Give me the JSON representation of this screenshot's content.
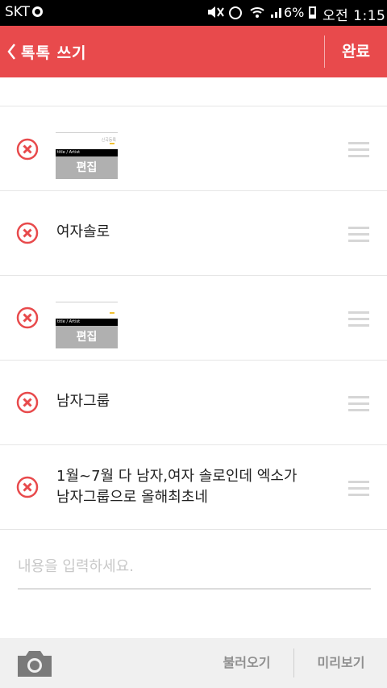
{
  "status_bar": {
    "carrier": "SKT",
    "battery_percent": "6%",
    "time": "오전 1:15",
    "icons": [
      "mute-icon",
      "alarm-icon",
      "wifi-icon",
      "signal-icon",
      "battery-icon"
    ]
  },
  "header": {
    "title": "톡톡 쓰기",
    "done_label": "완료",
    "background_color": "#e84a4c"
  },
  "items": [
    {
      "type": "image",
      "edit_label": "편집",
      "thumb_title": "title / Artist",
      "thumb_badge": "신곡등록"
    },
    {
      "type": "text",
      "text": "여자솔로"
    },
    {
      "type": "image",
      "edit_label": "편집",
      "thumb_title": "title / Artist"
    },
    {
      "type": "text",
      "text": "남자그룹"
    },
    {
      "type": "text",
      "text": "1월~7월 다 남자,여자 솔로인데 엑소가\n남자그룹으로 올해최초네"
    }
  ],
  "input": {
    "placeholder": "내용을 입력하세요."
  },
  "bottom_bar": {
    "load_label": "불러오기",
    "preview_label": "미리보기",
    "camera_icon": "camera-icon"
  }
}
